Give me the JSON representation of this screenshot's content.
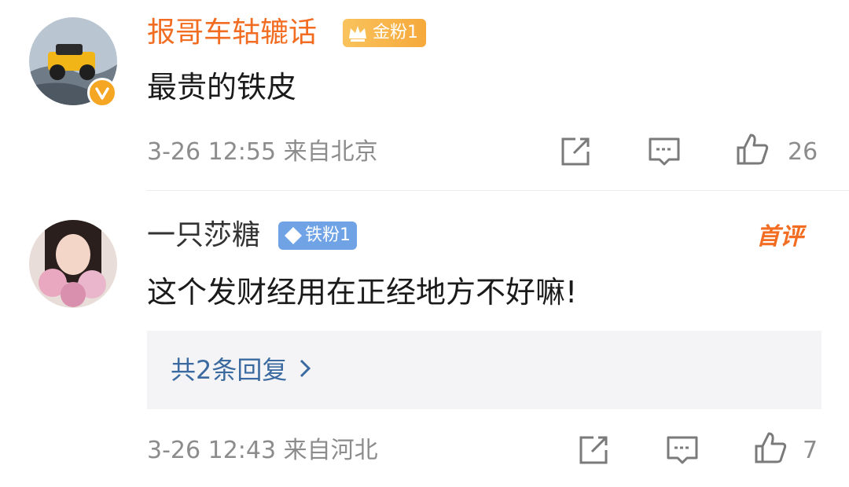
{
  "comments": [
    {
      "username": "报哥车轱辘话",
      "fan_badge": "金粉1",
      "text": "最贵的铁皮",
      "meta": "3-26 12:55 来自北京",
      "likes": "26",
      "colors": {
        "username": "#f26d22",
        "badge": "#f7b54b",
        "verified": "#f5a623"
      }
    },
    {
      "username": "一只莎糖",
      "fan_badge": "铁粉1",
      "tag": "首评",
      "text": "这个发财经用在正经地方不好嘛!",
      "replies_link": "共2条回复",
      "meta": "3-26 12:43 来自河北",
      "likes": "7",
      "colors": {
        "username": "#333333",
        "badge": "#6fa3e6",
        "link": "#3b6aa0"
      }
    }
  ]
}
